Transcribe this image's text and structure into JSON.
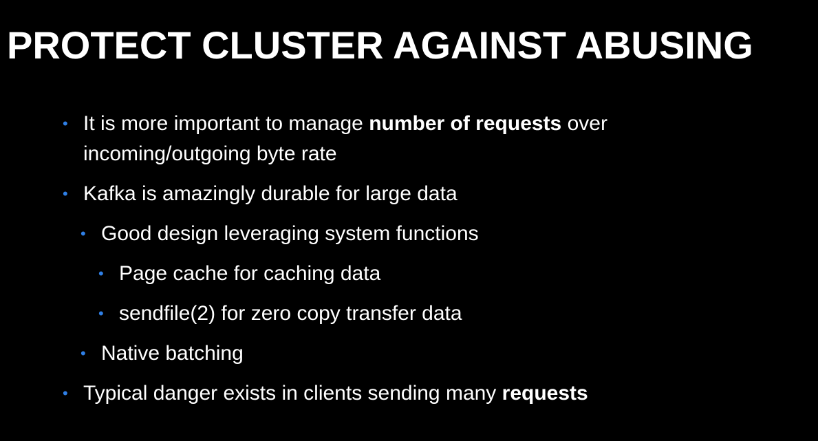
{
  "slide": {
    "title": "PROTECT CLUSTER AGAINST ABUSING",
    "bullet_glyph": "•",
    "accent_color": "#2f7fe6",
    "items": [
      {
        "level": 1,
        "parts": [
          {
            "text": "It is more important to manage ",
            "bold": false
          },
          {
            "text": "number of requests",
            "bold": true
          },
          {
            "text": " over",
            "bold": false
          }
        ],
        "continuation": "incoming/outgoing byte rate"
      },
      {
        "level": 1,
        "parts": [
          {
            "text": "Kafka is amazingly durable for large data",
            "bold": false
          }
        ]
      },
      {
        "level": 2,
        "parts": [
          {
            "text": "Good design leveraging system functions",
            "bold": false
          }
        ]
      },
      {
        "level": 3,
        "parts": [
          {
            "text": "Page cache for caching data",
            "bold": false
          }
        ]
      },
      {
        "level": 3,
        "parts": [
          {
            "text": "sendfile(2) for zero copy transfer data",
            "bold": false
          }
        ]
      },
      {
        "level": 2,
        "parts": [
          {
            "text": "Native batching",
            "bold": false
          }
        ]
      },
      {
        "level": 1,
        "parts": [
          {
            "text": "Typical danger exists in clients sending many ",
            "bold": false
          },
          {
            "text": "requests",
            "bold": true
          }
        ]
      }
    ]
  }
}
